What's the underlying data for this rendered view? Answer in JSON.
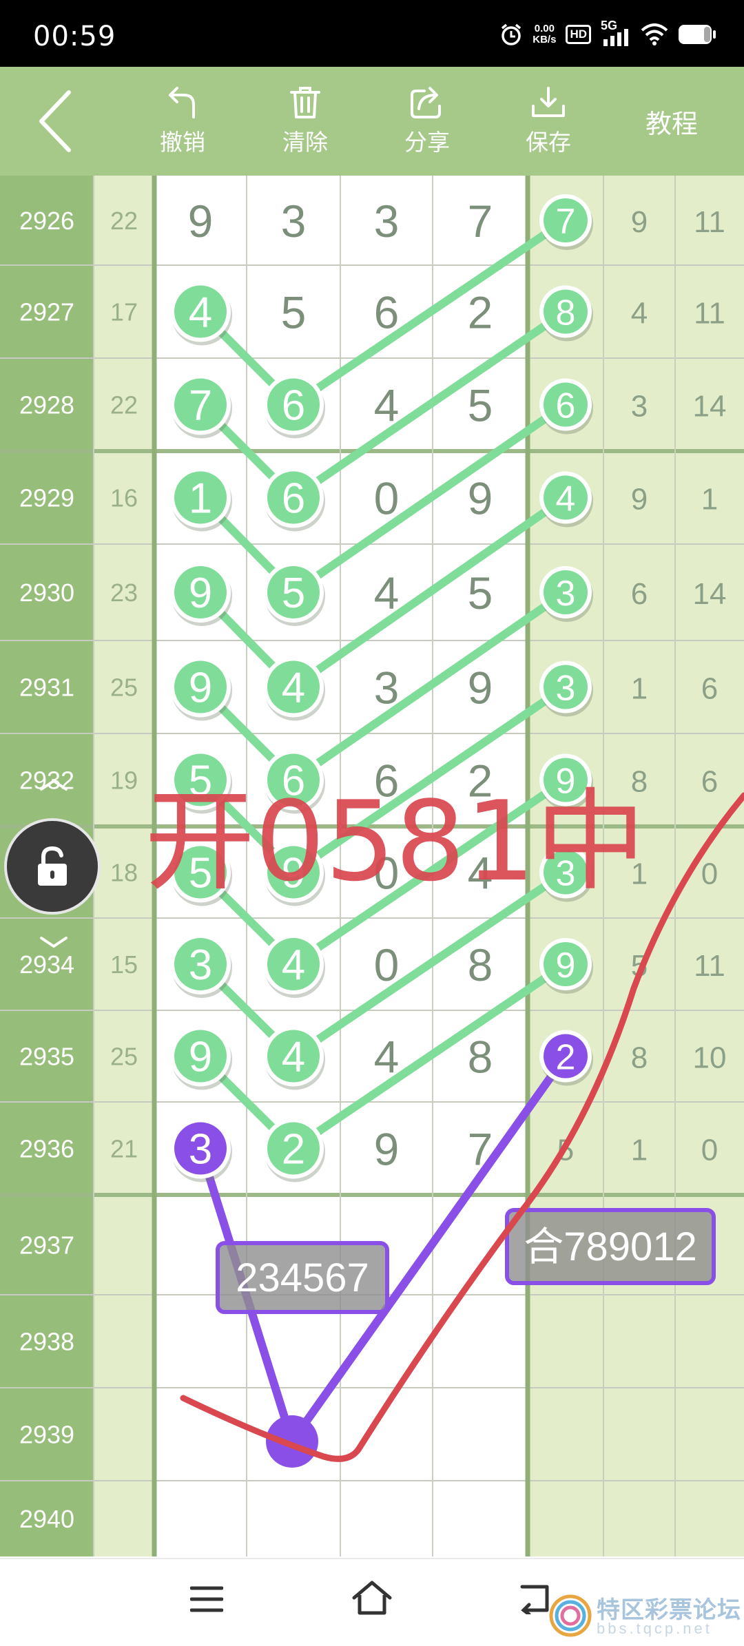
{
  "status_bar": {
    "time": "00:59",
    "net_speed_value": "0.00",
    "net_speed_unit": "KB/s",
    "hd_label": "HD",
    "network_label": "5G"
  },
  "toolbar": {
    "back_icon": "back-arrow-icon",
    "undo_label": "撤销",
    "clear_label": "清除",
    "share_label": "分享",
    "save_label": "保存",
    "tutorial_label": "教程"
  },
  "table": {
    "columns_per_row": [
      "period",
      "sum",
      "d1",
      "d2",
      "d3",
      "d4",
      "right1",
      "right2",
      "right3"
    ],
    "rows": [
      {
        "period": "2926",
        "sum": "22",
        "digits": [
          "9",
          "3",
          "3",
          "7"
        ],
        "right": [
          "7",
          "9",
          "11"
        ]
      },
      {
        "period": "2927",
        "sum": "17",
        "digits": [
          "4",
          "5",
          "6",
          "2"
        ],
        "right": [
          "8",
          "4",
          "11"
        ]
      },
      {
        "period": "2928",
        "sum": "22",
        "digits": [
          "7",
          "6",
          "4",
          "5"
        ],
        "right": [
          "6",
          "3",
          "14"
        ]
      },
      {
        "period": "2929",
        "sum": "16",
        "digits": [
          "1",
          "6",
          "0",
          "9"
        ],
        "right": [
          "4",
          "9",
          "1"
        ]
      },
      {
        "period": "2930",
        "sum": "23",
        "digits": [
          "9",
          "5",
          "4",
          "5"
        ],
        "right": [
          "3",
          "6",
          "14"
        ]
      },
      {
        "period": "2931",
        "sum": "25",
        "digits": [
          "9",
          "4",
          "3",
          "9"
        ],
        "right": [
          "3",
          "1",
          "6"
        ]
      },
      {
        "period": "2932",
        "sum": "19",
        "digits": [
          "5",
          "6",
          "6",
          "2"
        ],
        "right": [
          "9",
          "8",
          "6"
        ]
      },
      {
        "period": "2933",
        "sum": "18",
        "digits": [
          "5",
          "9",
          "0",
          "4"
        ],
        "right": [
          "3",
          "1",
          "0"
        ]
      },
      {
        "period": "2934",
        "sum": "15",
        "digits": [
          "3",
          "4",
          "0",
          "8"
        ],
        "right": [
          "9",
          "5",
          "11"
        ]
      },
      {
        "period": "2935",
        "sum": "25",
        "digits": [
          "9",
          "4",
          "4",
          "8"
        ],
        "right": [
          "2",
          "8",
          "10"
        ]
      },
      {
        "period": "2936",
        "sum": "21",
        "digits": [
          "3",
          "2",
          "9",
          "7"
        ],
        "right": [
          "5",
          "1",
          "0"
        ]
      },
      {
        "period": "2937",
        "sum": "",
        "digits": [
          "",
          "",
          "",
          ""
        ],
        "right": [
          "",
          "",
          ""
        ]
      },
      {
        "period": "2938",
        "sum": "",
        "digits": [
          "",
          "",
          "",
          ""
        ],
        "right": [
          "",
          "",
          ""
        ]
      },
      {
        "period": "2939",
        "sum": "",
        "digits": [
          "",
          "",
          "",
          ""
        ],
        "right": [
          "",
          "",
          ""
        ]
      },
      {
        "period": "2940",
        "sum": "",
        "digits": [
          "",
          "",
          "",
          ""
        ],
        "right": [
          "",
          "",
          ""
        ]
      }
    ],
    "marked": {
      "green_col1": [
        1,
        2,
        3,
        4,
        5,
        6,
        7,
        8,
        9
      ],
      "green_col2": [
        2,
        3,
        4,
        5,
        6,
        7,
        8,
        9,
        10
      ],
      "green_right1": [
        0,
        1,
        2,
        3,
        4,
        5,
        6,
        7,
        8
      ],
      "purple": [
        {
          "row": 10,
          "col": "d1"
        },
        {
          "row": 9,
          "col": "right1"
        }
      ],
      "colors": {
        "green": "#7fdc99",
        "purple": "#8a4fe6",
        "red": "#d9474f"
      }
    }
  },
  "annotations": {
    "handwritten": "开0581中",
    "label_left": "234567",
    "label_right": "合789012"
  },
  "side": {
    "lock_icon": "unlock-icon"
  },
  "nav": {
    "menu_icon": "menu-icon",
    "home_icon": "home-icon",
    "back_icon": "nav-back-icon"
  },
  "watermark": {
    "title": "特区彩票论坛",
    "url": "bbs.tqcp.net"
  }
}
